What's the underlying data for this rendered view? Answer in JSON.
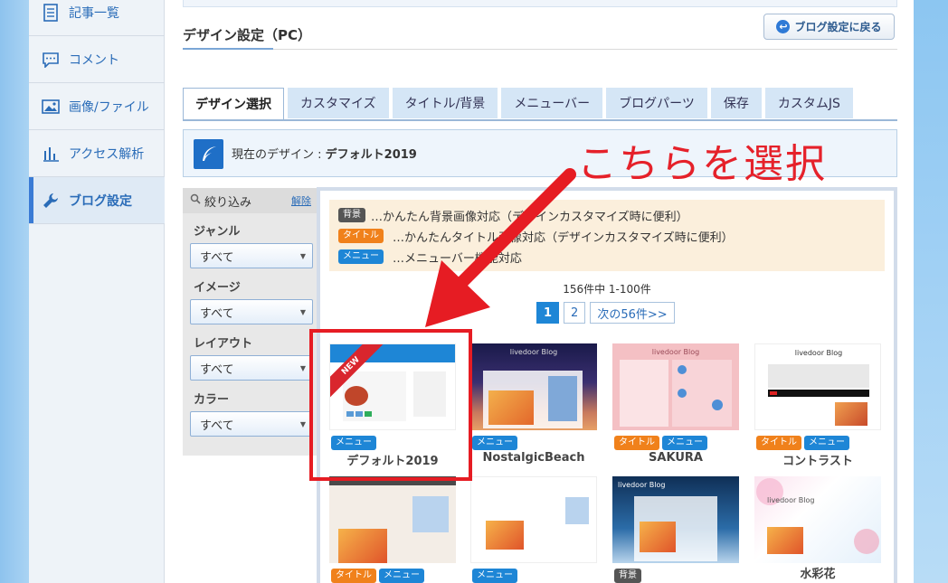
{
  "sidebar": {
    "items": [
      {
        "label": "記事一覧",
        "icon": "document-icon"
      },
      {
        "label": "コメント",
        "icon": "comment-icon"
      },
      {
        "label": "画像/ファイル",
        "icon": "image-icon"
      },
      {
        "label": "アクセス解析",
        "icon": "bar-chart-icon"
      },
      {
        "label": "ブログ設定",
        "icon": "wrench-icon",
        "active": true
      }
    ]
  },
  "header": {
    "title": "デザイン設定（PC）",
    "back_button": "ブログ設定に戻る"
  },
  "tabs": [
    "デザイン選択",
    "カスタマイズ",
    "タイトル/背景",
    "メニューバー",
    "ブログパーツ",
    "保存",
    "カスタムJS"
  ],
  "active_tab": "デザイン選択",
  "current_design": {
    "label": "現在のデザイン : ",
    "name": "デフォルト2019"
  },
  "filter": {
    "title": "絞り込み",
    "reset": "解除",
    "groups": [
      {
        "label": "ジャンル",
        "value": "すべて"
      },
      {
        "label": "イメージ",
        "value": "すべて"
      },
      {
        "label": "レイアウト",
        "value": "すべて"
      },
      {
        "label": "カラー",
        "value": "すべて"
      }
    ]
  },
  "legend": [
    {
      "badge": "背景",
      "text": "…かんたん背景画像対応（デザインカスタマイズ時に便利）"
    },
    {
      "badge": "タイトル",
      "text": "…かんたんタイトル画像対応（デザインカスタマイズ時に便利）"
    },
    {
      "badge": "メニュー",
      "text": "…メニューバー機能対応"
    }
  ],
  "pagination": {
    "summary": "156件中 1-100件",
    "pages": [
      "1",
      "2"
    ],
    "next": "次の56件>>"
  },
  "themes": [
    {
      "name": "デフォルト2019",
      "badges": [
        "メニュー"
      ],
      "new_label": "NEW"
    },
    {
      "name": "NostalgicBeach",
      "badges": [
        "メニュー"
      ],
      "thumb_title": "livedoor Blog"
    },
    {
      "name": "SAKURA",
      "badges": [
        "タイトル",
        "メニュー"
      ],
      "thumb_title": "livedoor Blog"
    },
    {
      "name": "コントラスト",
      "badges": [
        "タイトル",
        "メニュー"
      ],
      "thumb_title": "livedoor Blog"
    },
    {
      "name": "",
      "badges": [
        "タイトル",
        "メニュー"
      ]
    },
    {
      "name": "",
      "badges": [
        "メニュー"
      ]
    },
    {
      "name": "",
      "badges": [
        "背景"
      ],
      "thumb_title": "livedoor Blog"
    },
    {
      "name": "水彩花",
      "badges": [],
      "thumb_title": "livedoor Blog"
    }
  ],
  "annotation": "こちらを選択",
  "colors": {
    "accent": "#1e86d6",
    "annotation_red": "#e61c23",
    "badge_title": "#f0811b",
    "badge_bg": "#555555"
  }
}
